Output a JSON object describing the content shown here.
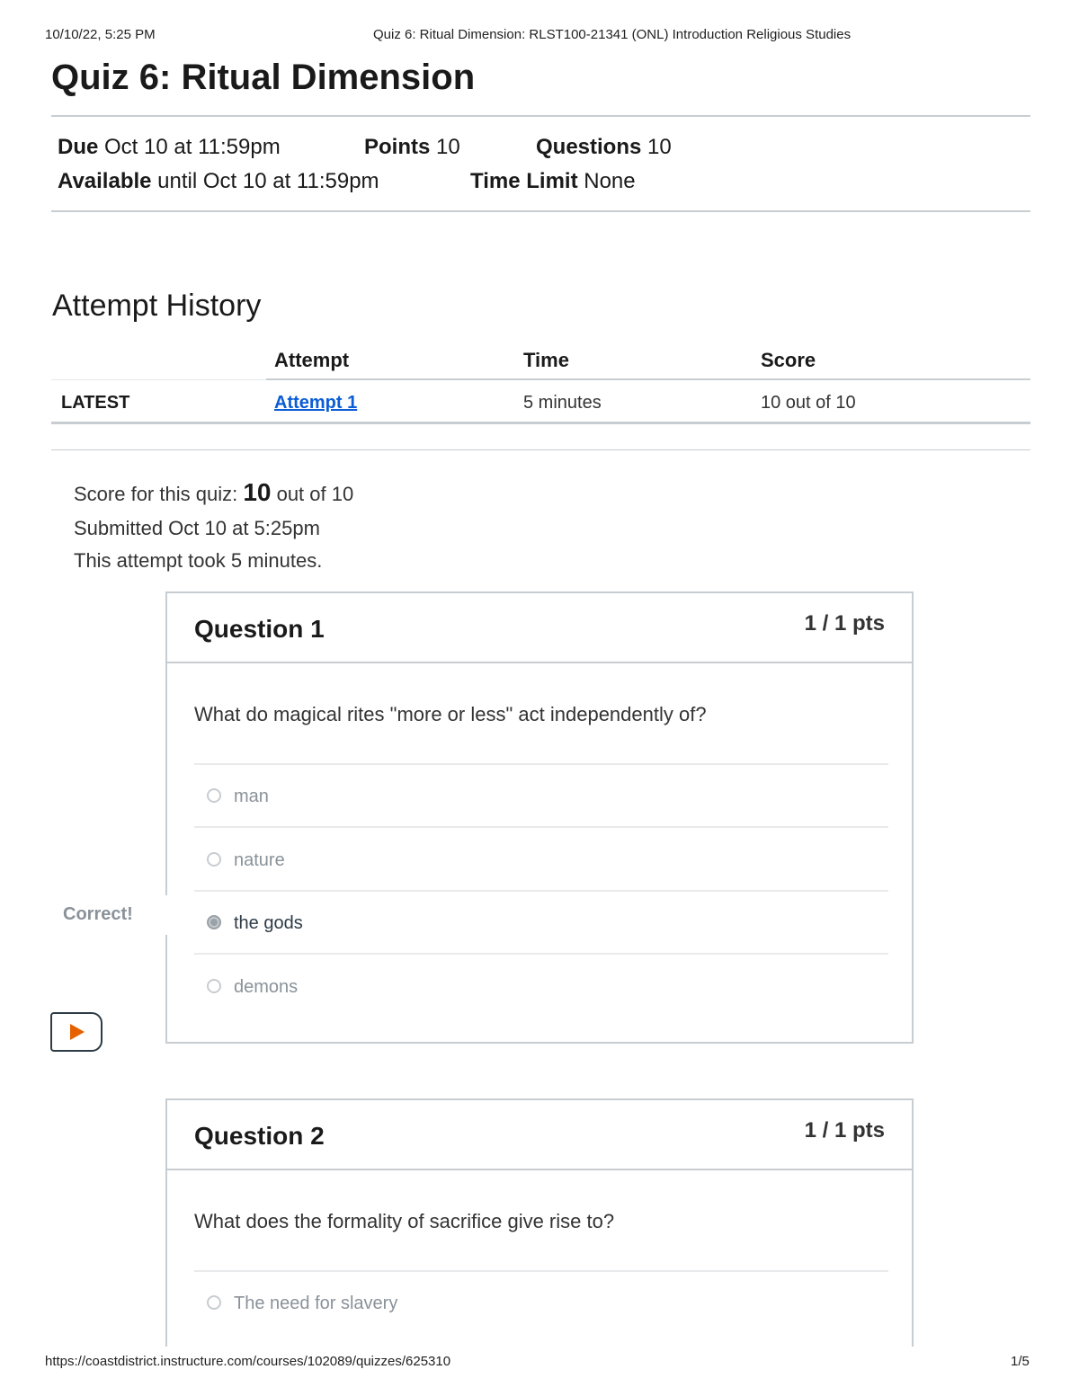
{
  "print_header": {
    "datetime": "10/10/22, 5:25 PM",
    "page_title": "Quiz 6: Ritual Dimension: RLST100-21341 (ONL) Introduction Religious Studies"
  },
  "quiz": {
    "title": "Quiz 6: Ritual Dimension",
    "due_label": "Due",
    "due_value": "Oct 10 at 11:59pm",
    "points_label": "Points",
    "points_value": "10",
    "questions_label": "Questions",
    "questions_value": "10",
    "available_label": "Available",
    "available_value": "until Oct 10 at 11:59pm",
    "time_limit_label": "Time Limit",
    "time_limit_value": "None"
  },
  "attempt_history": {
    "heading": "Attempt History",
    "columns": [
      "Attempt",
      "Time",
      "Score"
    ],
    "row": {
      "tag": "LATEST",
      "attempt": "Attempt 1",
      "time": "5 minutes",
      "score": "10 out of 10"
    }
  },
  "summary": {
    "score_prefix": "Score for this quiz: ",
    "score_value": "10",
    "score_suffix": " out of 10",
    "submitted": "Submitted Oct 10 at 5:25pm",
    "duration": "This attempt took 5 minutes."
  },
  "questions": [
    {
      "title": "Question 1",
      "points": "1 / 1 pts",
      "text": "What do magical rites \"more or less\" act independently of?",
      "answers": [
        "man",
        "nature",
        "the gods",
        "demons"
      ],
      "selected_index": 2,
      "result_label": "Correct!"
    },
    {
      "title": "Question 2",
      "points": "1 / 1 pts",
      "text": "What does the formality of sacrifice give rise to?",
      "answers": [
        "The need for slavery"
      ]
    }
  ],
  "footer": {
    "url": "https://coastdistrict.instructure.com/courses/102089/quizzes/625310",
    "page": "1/5"
  },
  "colors": {
    "link": "#0b5cd5",
    "play_icon": "#e66000",
    "border": "#c7cdd1"
  }
}
